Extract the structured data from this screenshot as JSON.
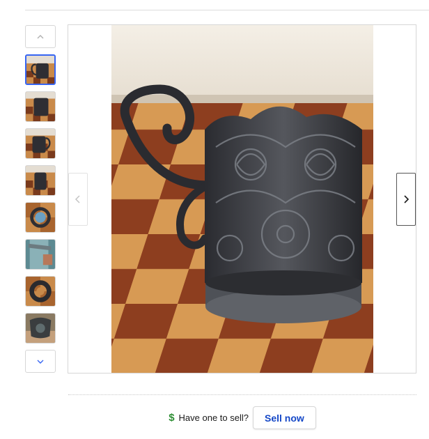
{
  "gallery": {
    "thumbnails": [
      {
        "name": "thumbnail-1",
        "selected": true
      },
      {
        "name": "thumbnail-2",
        "selected": false
      },
      {
        "name": "thumbnail-3",
        "selected": false
      },
      {
        "name": "thumbnail-4",
        "selected": false
      },
      {
        "name": "thumbnail-5",
        "selected": false
      },
      {
        "name": "thumbnail-6",
        "selected": false
      },
      {
        "name": "thumbnail-7",
        "selected": false
      },
      {
        "name": "thumbnail-8",
        "selected": false
      }
    ],
    "icons": {
      "up": "chevron-up-icon",
      "down": "chevron-down-icon",
      "prev": "chevron-left-icon",
      "next": "chevron-right-icon"
    }
  },
  "sell": {
    "icon": "dollar-icon",
    "icon_glyph": "$",
    "question": "Have one to sell?",
    "button_label": "Sell now"
  },
  "colors": {
    "accent": "#3665f3",
    "link": "#1447c7",
    "dollar": "#2f8f35"
  }
}
